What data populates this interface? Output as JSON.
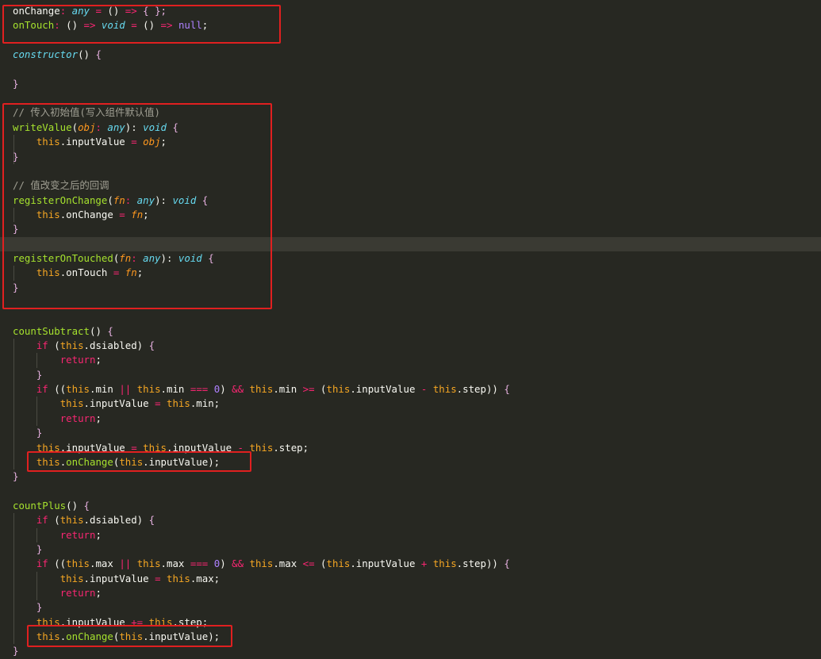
{
  "editor": {
    "background": "#272822",
    "highlighted_line": 16,
    "lines": [
      [
        [
          "plain",
          "onChange"
        ],
        [
          "op",
          ": "
        ],
        [
          "type",
          "any"
        ],
        [
          "op",
          " = "
        ],
        [
          "paren",
          "() "
        ],
        [
          "op",
          "=>"
        ],
        [
          "brace",
          " { };"
        ]
      ],
      [
        [
          "fn",
          "onTouch"
        ],
        [
          "op",
          ": "
        ],
        [
          "paren",
          "() "
        ],
        [
          "op",
          "=> "
        ],
        [
          "type",
          "void"
        ],
        [
          "op",
          " = "
        ],
        [
          "paren",
          "() "
        ],
        [
          "op",
          "=> "
        ],
        [
          "null",
          "null"
        ],
        [
          "plain",
          ";"
        ]
      ],
      [],
      [
        [
          "ctor",
          "constructor"
        ],
        [
          "paren",
          "() "
        ],
        [
          "brace",
          "{"
        ]
      ],
      [],
      [
        [
          "brace",
          "}"
        ]
      ],
      [],
      [
        [
          "comment",
          "// 传入初始值(写入组件默认值)"
        ]
      ],
      [
        [
          "fn",
          "writeValue"
        ],
        [
          "paren",
          "("
        ],
        [
          "param",
          "obj"
        ],
        [
          "op",
          ": "
        ],
        [
          "type",
          "any"
        ],
        [
          "paren",
          "): "
        ],
        [
          "type",
          "void"
        ],
        [
          "brace",
          " {"
        ]
      ],
      [
        [
          "plain",
          "    "
        ],
        [
          "this",
          "this"
        ],
        [
          "plain",
          ".inputValue "
        ],
        [
          "op",
          "="
        ],
        [
          "plain",
          " "
        ],
        [
          "param",
          "obj"
        ],
        [
          "plain",
          ";"
        ]
      ],
      [
        [
          "brace",
          "}"
        ]
      ],
      [],
      [
        [
          "comment",
          "// 值改变之后的回调"
        ]
      ],
      [
        [
          "fn",
          "registerOnChange"
        ],
        [
          "paren",
          "("
        ],
        [
          "param",
          "fn"
        ],
        [
          "op",
          ": "
        ],
        [
          "type",
          "any"
        ],
        [
          "paren",
          "): "
        ],
        [
          "type",
          "void"
        ],
        [
          "brace",
          " {"
        ]
      ],
      [
        [
          "plain",
          "    "
        ],
        [
          "this",
          "this"
        ],
        [
          "plain",
          ".onChange "
        ],
        [
          "op",
          "="
        ],
        [
          "plain",
          " "
        ],
        [
          "param",
          "fn"
        ],
        [
          "plain",
          ";"
        ]
      ],
      [
        [
          "brace",
          "}"
        ]
      ],
      [],
      [
        [
          "fn",
          "registerOnTouched"
        ],
        [
          "paren",
          "("
        ],
        [
          "param",
          "fn"
        ],
        [
          "op",
          ": "
        ],
        [
          "type",
          "any"
        ],
        [
          "paren",
          "): "
        ],
        [
          "type",
          "void"
        ],
        [
          "brace",
          " {"
        ]
      ],
      [
        [
          "plain",
          "    "
        ],
        [
          "this",
          "this"
        ],
        [
          "plain",
          ".onTouch "
        ],
        [
          "op",
          "="
        ],
        [
          "plain",
          " "
        ],
        [
          "param",
          "fn"
        ],
        [
          "plain",
          ";"
        ]
      ],
      [
        [
          "brace",
          "}"
        ]
      ],
      [],
      [],
      [
        [
          "fn",
          "countSubtract"
        ],
        [
          "paren",
          "() "
        ],
        [
          "brace",
          "{"
        ]
      ],
      [
        [
          "plain",
          "    "
        ],
        [
          "cond",
          "if"
        ],
        [
          "plain",
          " ("
        ],
        [
          "this",
          "this"
        ],
        [
          "plain",
          ".dsiabled) "
        ],
        [
          "brace",
          "{"
        ]
      ],
      [
        [
          "plain",
          "        "
        ],
        [
          "kw",
          "return"
        ],
        [
          "plain",
          ";"
        ]
      ],
      [
        [
          "plain",
          "    "
        ],
        [
          "brace",
          "}"
        ]
      ],
      [
        [
          "plain",
          "    "
        ],
        [
          "cond",
          "if"
        ],
        [
          "plain",
          " (("
        ],
        [
          "this",
          "this"
        ],
        [
          "plain",
          ".min "
        ],
        [
          "op",
          "||"
        ],
        [
          "plain",
          " "
        ],
        [
          "this",
          "this"
        ],
        [
          "plain",
          ".min "
        ],
        [
          "op",
          "==="
        ],
        [
          "plain",
          " "
        ],
        [
          "num",
          "0"
        ],
        [
          "plain",
          ") "
        ],
        [
          "op",
          "&&"
        ],
        [
          "plain",
          " "
        ],
        [
          "this",
          "this"
        ],
        [
          "plain",
          ".min "
        ],
        [
          "op",
          ">="
        ],
        [
          "plain",
          " ("
        ],
        [
          "this",
          "this"
        ],
        [
          "plain",
          ".inputValue "
        ],
        [
          "op",
          "-"
        ],
        [
          "plain",
          " "
        ],
        [
          "this",
          "this"
        ],
        [
          "plain",
          ".step)) "
        ],
        [
          "brace",
          "{"
        ]
      ],
      [
        [
          "plain",
          "        "
        ],
        [
          "this",
          "this"
        ],
        [
          "plain",
          ".inputValue "
        ],
        [
          "op",
          "="
        ],
        [
          "plain",
          " "
        ],
        [
          "this",
          "this"
        ],
        [
          "plain",
          ".min;"
        ]
      ],
      [
        [
          "plain",
          "        "
        ],
        [
          "kw",
          "return"
        ],
        [
          "plain",
          ";"
        ]
      ],
      [
        [
          "plain",
          "    "
        ],
        [
          "brace",
          "}"
        ]
      ],
      [
        [
          "plain",
          "    "
        ],
        [
          "this",
          "this"
        ],
        [
          "plain",
          ".inputValue "
        ],
        [
          "op",
          "="
        ],
        [
          "plain",
          " "
        ],
        [
          "this",
          "this"
        ],
        [
          "plain",
          ".inputValue "
        ],
        [
          "op",
          "-"
        ],
        [
          "plain",
          " "
        ],
        [
          "this",
          "this"
        ],
        [
          "plain",
          ".step;"
        ]
      ],
      [
        [
          "plain",
          "    "
        ],
        [
          "this",
          "this"
        ],
        [
          "plain",
          "."
        ],
        [
          "fn",
          "onChange"
        ],
        [
          "plain",
          "("
        ],
        [
          "this",
          "this"
        ],
        [
          "plain",
          ".inputValue);"
        ]
      ],
      [
        [
          "brace",
          "}"
        ]
      ],
      [],
      [
        [
          "fn",
          "countPlus"
        ],
        [
          "paren",
          "() "
        ],
        [
          "brace",
          "{"
        ]
      ],
      [
        [
          "plain",
          "    "
        ],
        [
          "cond",
          "if"
        ],
        [
          "plain",
          " ("
        ],
        [
          "this",
          "this"
        ],
        [
          "plain",
          ".dsiabled) "
        ],
        [
          "brace",
          "{"
        ]
      ],
      [
        [
          "plain",
          "        "
        ],
        [
          "kw",
          "return"
        ],
        [
          "plain",
          ";"
        ]
      ],
      [
        [
          "plain",
          "    "
        ],
        [
          "brace",
          "}"
        ]
      ],
      [
        [
          "plain",
          "    "
        ],
        [
          "cond",
          "if"
        ],
        [
          "plain",
          " (("
        ],
        [
          "this",
          "this"
        ],
        [
          "plain",
          ".max "
        ],
        [
          "op",
          "||"
        ],
        [
          "plain",
          " "
        ],
        [
          "this",
          "this"
        ],
        [
          "plain",
          ".max "
        ],
        [
          "op",
          "==="
        ],
        [
          "plain",
          " "
        ],
        [
          "num",
          "0"
        ],
        [
          "plain",
          ") "
        ],
        [
          "op",
          "&&"
        ],
        [
          "plain",
          " "
        ],
        [
          "this",
          "this"
        ],
        [
          "plain",
          ".max "
        ],
        [
          "op",
          "<="
        ],
        [
          "plain",
          " ("
        ],
        [
          "this",
          "this"
        ],
        [
          "plain",
          ".inputValue "
        ],
        [
          "op",
          "+"
        ],
        [
          "plain",
          " "
        ],
        [
          "this",
          "this"
        ],
        [
          "plain",
          ".step)) "
        ],
        [
          "brace",
          "{"
        ]
      ],
      [
        [
          "plain",
          "        "
        ],
        [
          "this",
          "this"
        ],
        [
          "plain",
          ".inputValue "
        ],
        [
          "op",
          "="
        ],
        [
          "plain",
          " "
        ],
        [
          "this",
          "this"
        ],
        [
          "plain",
          ".max;"
        ]
      ],
      [
        [
          "plain",
          "        "
        ],
        [
          "kw",
          "return"
        ],
        [
          "plain",
          ";"
        ]
      ],
      [
        [
          "plain",
          "    "
        ],
        [
          "brace",
          "}"
        ]
      ],
      [
        [
          "plain",
          "    "
        ],
        [
          "this",
          "this"
        ],
        [
          "plain",
          ".inputValue "
        ],
        [
          "op",
          "+="
        ],
        [
          "plain",
          " "
        ],
        [
          "this",
          "this"
        ],
        [
          "plain",
          ".step;"
        ]
      ],
      [
        [
          "plain",
          "    "
        ],
        [
          "this",
          "this"
        ],
        [
          "plain",
          "."
        ],
        [
          "fn",
          "onChange"
        ],
        [
          "plain",
          "("
        ],
        [
          "this",
          "this"
        ],
        [
          "plain",
          ".inputValue);"
        ]
      ],
      [
        [
          "brace",
          "}"
        ]
      ]
    ]
  },
  "annotations": {
    "color": "#e02020",
    "boxes": [
      "callback-properties-box",
      "control-value-accessor-methods-box",
      "count-subtract-onchange-call-box",
      "count-plus-onchange-call-box"
    ]
  }
}
